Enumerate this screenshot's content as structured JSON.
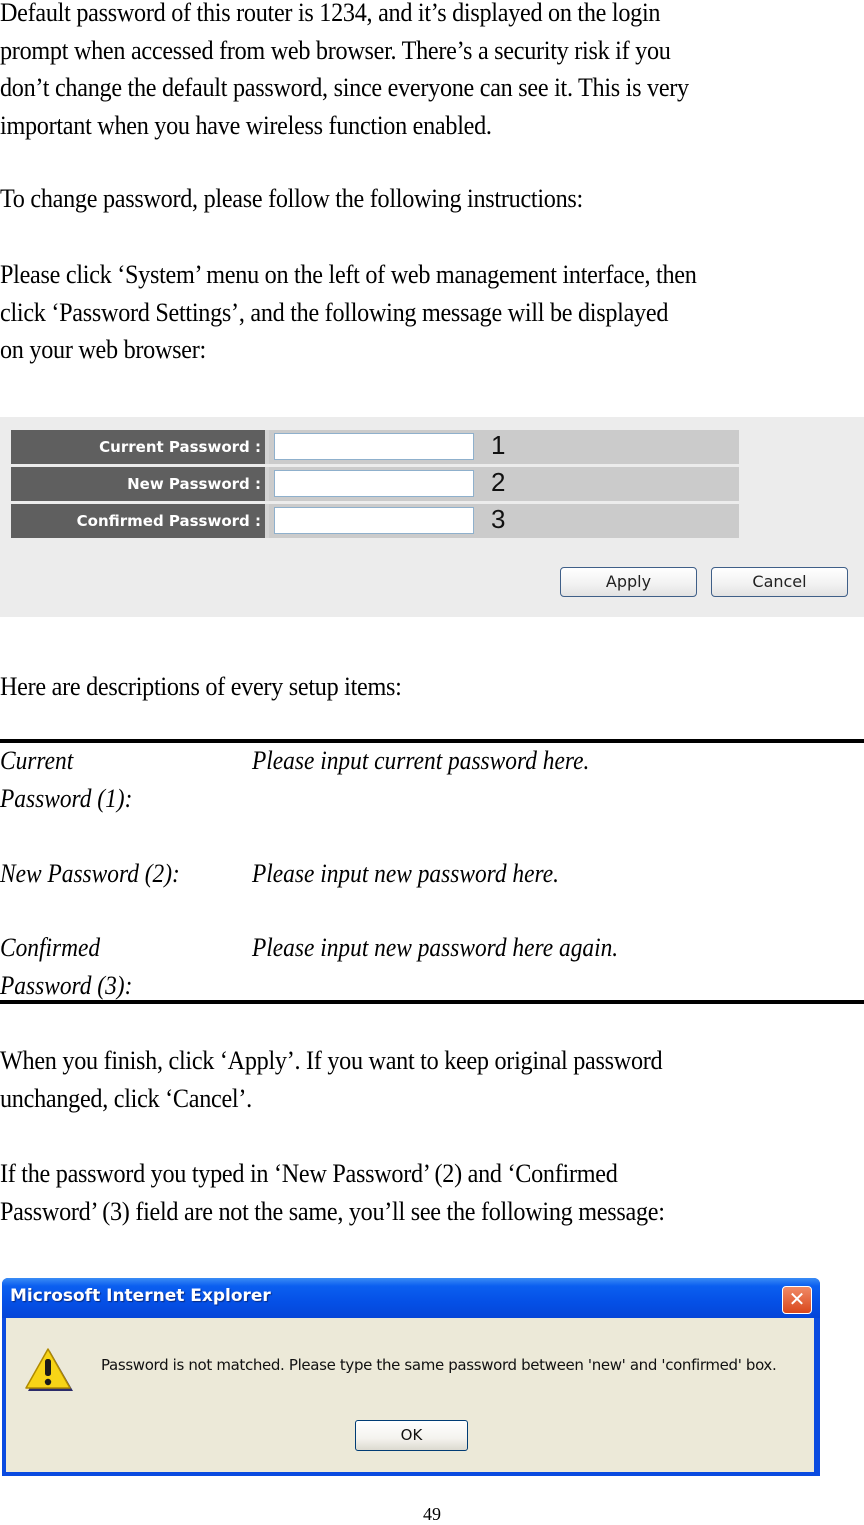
{
  "intro": {
    "lines": [
      "Default password of this router is 1234, and it’s displayed on the login",
      "prompt when accessed from web browser. There’s a security risk if you",
      "don’t change the default password, since everyone can see it. This is very",
      "important when you have wireless function enabled."
    ]
  },
  "instructions_intro": "To change password, please follow the following instructions:",
  "navigation": {
    "lines": [
      "Please click ‘System’ menu on the left of web management interface, then",
      "click ‘Password Settings’, and the following message will be displayed",
      "on your web browser:"
    ]
  },
  "router_form": {
    "fields": [
      {
        "label": "Current Password :",
        "value": "",
        "marker": "1"
      },
      {
        "label": "New Password :",
        "value": "",
        "marker": "2"
      },
      {
        "label": "Confirmed Password :",
        "value": "",
        "marker": "3"
      }
    ],
    "apply_label": "Apply",
    "cancel_label": "Cancel"
  },
  "descriptions_intro": "Here are descriptions of every setup items:",
  "descriptions": [
    {
      "term_lines": [
        "Current",
        "Password (1):"
      ],
      "text": "Please input current password here."
    },
    {
      "term_lines": [
        "New Password (2):"
      ],
      "text": "Please input new password here."
    },
    {
      "term_lines": [
        "Confirmed",
        "Password (3):"
      ],
      "text": "Please input new password here again."
    }
  ],
  "apply_note": {
    "lines": [
      "When you finish, click ‘Apply’. If you want to keep original password",
      "unchanged, click ‘Cancel’."
    ]
  },
  "mismatch_note": {
    "lines": [
      "If the password you typed in ‘New Password’ (2) and ‘Confirmed",
      "Password’ (3) field are not the same, you’ll see the following message:"
    ]
  },
  "dialog": {
    "title": "Microsoft Internet Explorer",
    "message": "Password is not matched. Please type the same password between 'new' and 'confirmed' box.",
    "ok_label": "OK",
    "icon": "warning-icon",
    "close_icon": "close-icon"
  },
  "page_number": "49"
}
